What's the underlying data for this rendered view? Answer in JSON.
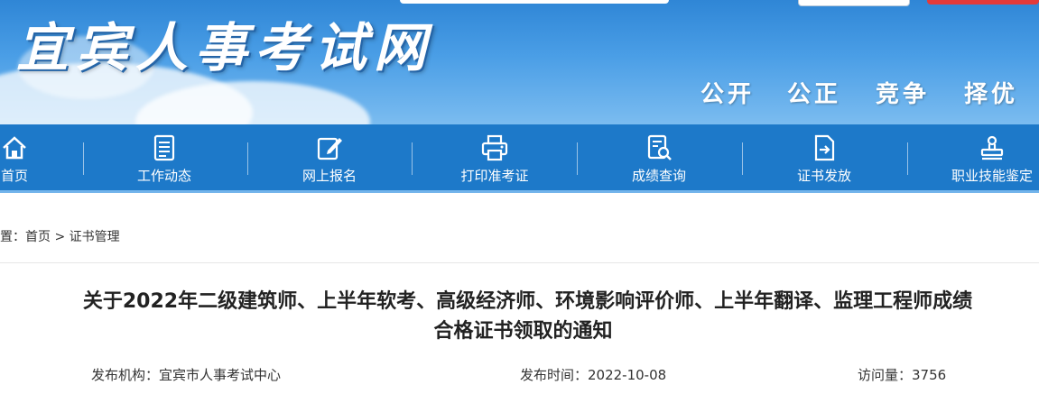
{
  "header": {
    "site_title": "宜宾人事考试网",
    "mottos": [
      "公开",
      "公正",
      "竞争",
      "择优"
    ]
  },
  "nav": {
    "items": [
      {
        "label": "首页",
        "icon": "home-icon"
      },
      {
        "label": "工作动态",
        "icon": "news-list-icon"
      },
      {
        "label": "网上报名",
        "icon": "edit-icon"
      },
      {
        "label": "打印准考证",
        "icon": "printer-icon"
      },
      {
        "label": "成绩查询",
        "icon": "search-document-icon"
      },
      {
        "label": "证书发放",
        "icon": "certificate-export-icon"
      },
      {
        "label": "职业技能鉴定",
        "icon": "stamp-icon"
      }
    ]
  },
  "breadcrumb": {
    "prefix": "位置：",
    "home": "首页",
    "separator": ">",
    "current": "证书管理"
  },
  "article": {
    "title_line1": "关于2022年二级建筑师、上半年软考、高级经济师、环境影响评价师、上半年翻译、监理工程师成绩",
    "title_line2": "合格证书领取的通知",
    "publisher": "发布机构：宜宾市人事考试中心",
    "publish_time": "发布时间：2022-10-08",
    "visits": "访问量：3756"
  },
  "colors": {
    "nav_bg": "#1d79c9",
    "banner_top": "#2f86d6",
    "accent_red": "#e43a3a"
  }
}
